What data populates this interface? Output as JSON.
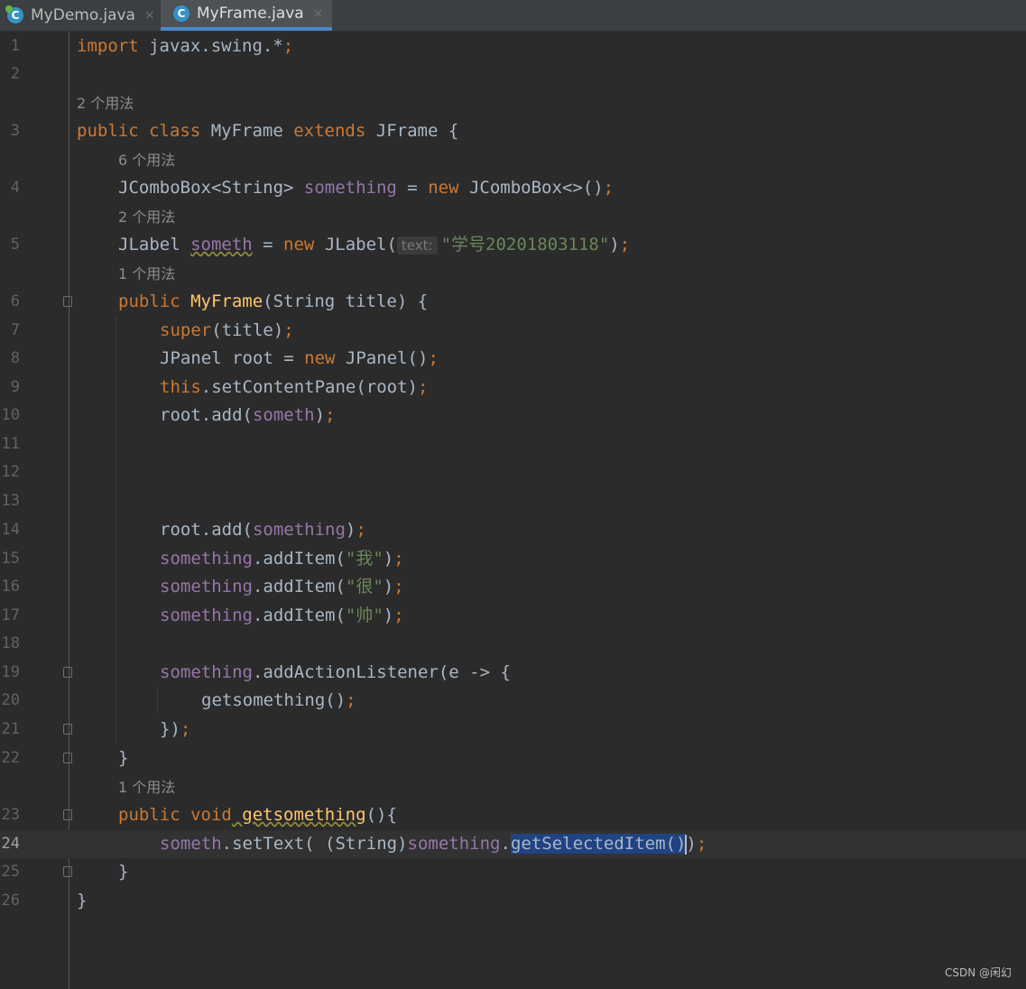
{
  "tabs": [
    {
      "label": "MyDemo.java",
      "icon": "class-icon",
      "close": "×"
    },
    {
      "label": "MyFrame.java",
      "icon": "class-icon",
      "close": "×",
      "active": true
    }
  ],
  "hints": {
    "h3": "2 个用法",
    "h4": "6 个用法",
    "h5": "2 个用法",
    "h6": "1 个用法",
    "h23": "1 个用法"
  },
  "lines": {
    "l1": {
      "num": "1",
      "t1": "import",
      "t2": " javax.swing.*",
      "t3": ";"
    },
    "l2": {
      "num": "2"
    },
    "l3": {
      "num": "3",
      "t1": "public class",
      "t2": " MyFrame ",
      "t3": "extends",
      "t4": " JFrame {"
    },
    "l4": {
      "num": "4",
      "t1": "JComboBox<String> ",
      "t2": "something",
      "t3": " = ",
      "t4": "new",
      "t5": " JComboBox<>()",
      "t6": ";"
    },
    "l5": {
      "num": "5",
      "t1": "JLabel ",
      "t2": "someth",
      "t3": " = ",
      "t4": "new",
      "t5": " JLabel(",
      "hint": "text:",
      "t6": "\"学号20201803118\"",
      "t7": ")",
      "t8": ";"
    },
    "l6": {
      "num": "6",
      "t1": "public",
      "t2": " MyFrame",
      "t3": "(String title) {"
    },
    "l7": {
      "num": "7",
      "t1": "super",
      "t2": "(title)",
      "t3": ";"
    },
    "l8": {
      "num": "8",
      "t1": "JPanel root = ",
      "t2": "new",
      "t3": " JPanel()",
      "t4": ";"
    },
    "l9": {
      "num": "9",
      "t1": "this",
      "t2": ".setContentPane(root)",
      "t3": ";"
    },
    "l10": {
      "num": "10",
      "t1": "root.add(",
      "t2": "someth",
      "t3": ")",
      "t4": ";"
    },
    "l11": {
      "num": "11"
    },
    "l12": {
      "num": "12"
    },
    "l13": {
      "num": "13"
    },
    "l14": {
      "num": "14",
      "t1": "root.add(",
      "t2": "something",
      "t3": ")",
      "t4": ";"
    },
    "l15": {
      "num": "15",
      "t1": "something",
      "t2": ".addItem(",
      "t3": "\"我\"",
      "t4": ")",
      "t5": ";"
    },
    "l16": {
      "num": "16",
      "t1": "something",
      "t2": ".addItem(",
      "t3": "\"很\"",
      "t4": ")",
      "t5": ";"
    },
    "l17": {
      "num": "17",
      "t1": "something",
      "t2": ".addItem(",
      "t3": "\"帅\"",
      "t4": ")",
      "t5": ";"
    },
    "l18": {
      "num": "18"
    },
    "l19": {
      "num": "19",
      "t1": "something",
      "t2": ".addActionListener(e -> {"
    },
    "l20": {
      "num": "20",
      "t1": "getsomething()",
      "t2": ";"
    },
    "l21": {
      "num": "21",
      "t1": "})",
      "t2": ";"
    },
    "l22": {
      "num": "22",
      "t1": "}"
    },
    "l23": {
      "num": "23",
      "t1": "public void",
      "t2": " getsomething",
      "t3": "(){"
    },
    "l24": {
      "num": "24",
      "t1": "someth",
      "t2": ".setText( (String)",
      "t3": "something",
      "t4": ".",
      "t5": "getSelectedItem()",
      "t6": ")",
      "t7": ";"
    },
    "l25": {
      "num": "25",
      "t1": "}"
    },
    "l26": {
      "num": "26",
      "t1": "}"
    }
  },
  "watermark": "CSDN @闲幻",
  "colors": {
    "keyword": "#cc7832",
    "field": "#9876aa",
    "method": "#ffc66d",
    "string": "#6a8759",
    "text": "#a9b7c6",
    "selection": "#214283"
  }
}
